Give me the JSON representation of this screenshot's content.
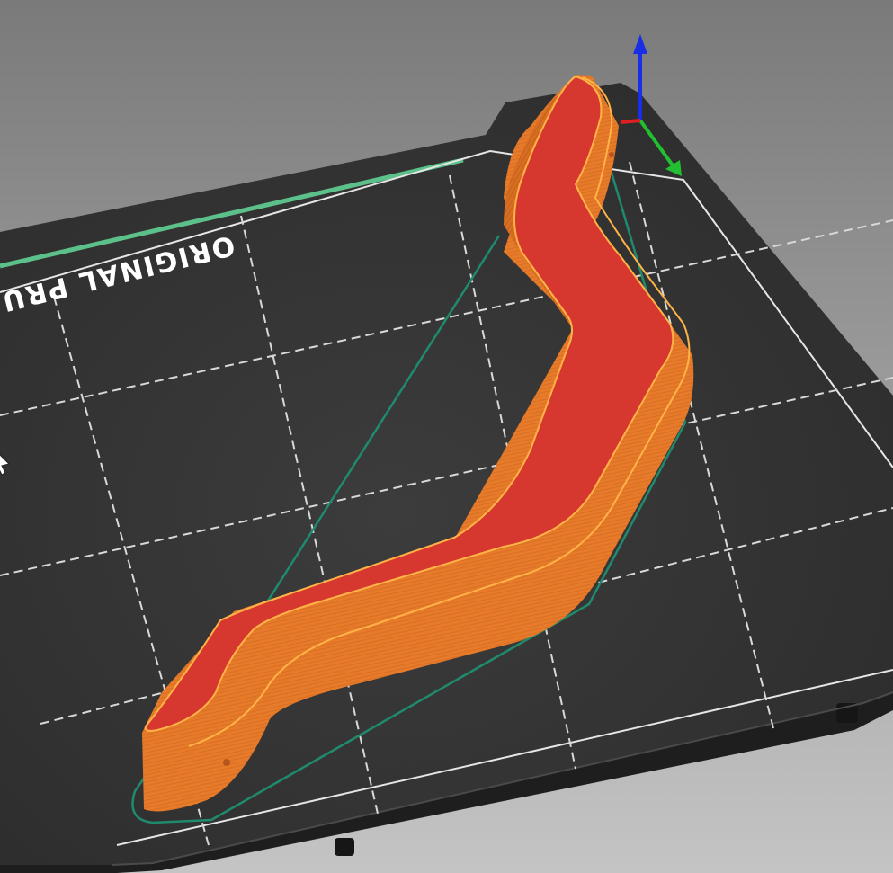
{
  "viewer": {
    "background_top": "#7a7a7a",
    "background_bottom": "#c4c4c4"
  },
  "bed": {
    "label": "ORIGINAL PRU",
    "color": "#343434",
    "edge_color": "#1e1e1e",
    "grid_color": "#d9d9d9",
    "label_color": "#ffffff",
    "stripe_color": "#5cc08a"
  },
  "model": {
    "top_color": "#d6382f",
    "side_color": "#e77b2a",
    "rim_color": "#ffb347",
    "skirt_color": "#1f8a6e"
  },
  "axes": {
    "x_color": "#e02020",
    "y_color": "#22c030",
    "z_color": "#1a2ee6"
  },
  "cursor": {
    "icon": "mouse-pointer-icon"
  }
}
